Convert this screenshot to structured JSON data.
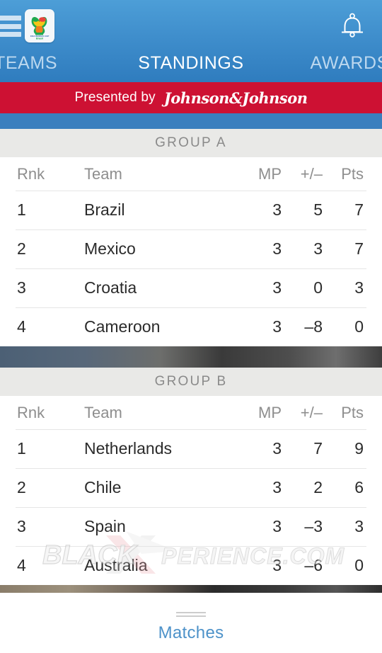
{
  "header": {
    "menu_icon": "hamburger-menu-icon",
    "logo_icon": "fifa-world-cup-brazil-2014-logo",
    "logo_caption_line1": "FIFA WORLD CUP",
    "logo_caption_line2": "Brasil",
    "notifications_icon": "bell-icon",
    "tabs": [
      {
        "label": "TEAMS",
        "active": false
      },
      {
        "label": "STANDINGS",
        "active": true
      },
      {
        "label": "AWARDS",
        "active": false
      }
    ]
  },
  "sponsor": {
    "prefix": "Presented by",
    "brand": "Johnson&Johnson",
    "background": "#cd1133"
  },
  "columns": {
    "rnk": "Rnk",
    "team": "Team",
    "mp": "MP",
    "plus_minus": "+/–",
    "pts": "Pts"
  },
  "groups": [
    {
      "title": "GROUP A",
      "rows": [
        {
          "rnk": "1",
          "team": "Brazil",
          "mp": "3",
          "plus_minus": "5",
          "pts": "7"
        },
        {
          "rnk": "2",
          "team": "Mexico",
          "mp": "3",
          "plus_minus": "3",
          "pts": "7"
        },
        {
          "rnk": "3",
          "team": "Croatia",
          "mp": "3",
          "plus_minus": "0",
          "pts": "3"
        },
        {
          "rnk": "4",
          "team": "Cameroon",
          "mp": "3",
          "plus_minus": "–8",
          "pts": "0"
        }
      ]
    },
    {
      "title": "GROUP B",
      "rows": [
        {
          "rnk": "1",
          "team": "Netherlands",
          "mp": "3",
          "plus_minus": "7",
          "pts": "9"
        },
        {
          "rnk": "2",
          "team": "Chile",
          "mp": "3",
          "plus_minus": "2",
          "pts": "6"
        },
        {
          "rnk": "3",
          "team": "Spain",
          "mp": "3",
          "plus_minus": "–3",
          "pts": "3"
        },
        {
          "rnk": "4",
          "team": "Australia",
          "mp": "3",
          "plus_minus": "–6",
          "pts": "0"
        }
      ]
    }
  ],
  "footer": {
    "handle_icon": "drag-handle-icon",
    "label": "Matches",
    "accent": "#4d92c9"
  },
  "watermark": {
    "text_left": "BLACK",
    "text_right": "PERIENCE.COM",
    "mark": "x-logo"
  }
}
